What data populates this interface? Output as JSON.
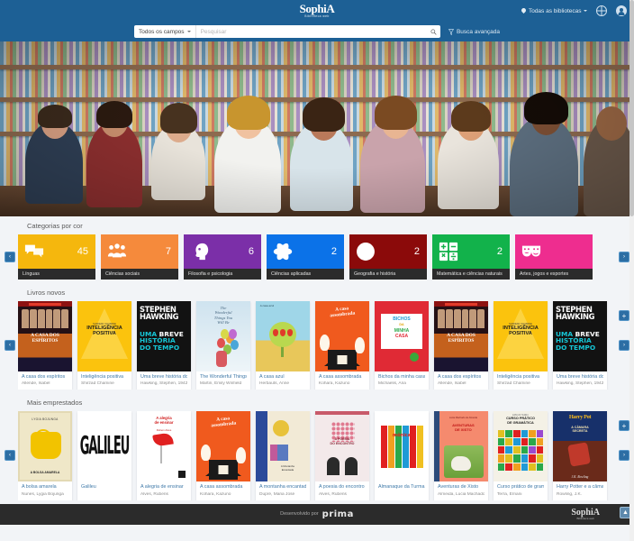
{
  "header": {
    "brand": "SophiA",
    "brand_sub": "Biblioteca web",
    "library_selector": "Todas as bibliotecas",
    "globe_icon": "globe-icon",
    "avatar_icon": "user-avatar-icon"
  },
  "search": {
    "field_selector": "Todos os campos",
    "placeholder": "Pesquisar",
    "value": "",
    "search_icon": "search-icon",
    "advanced_label": "Busca avançada",
    "filter_icon": "funnel-icon"
  },
  "hero": {
    "alt": "Estudantes em uma biblioteca"
  },
  "categories": {
    "title": "Categorias por cor",
    "prev_label": "‹",
    "next_label": "›",
    "items": [
      {
        "label": "Línguas",
        "count": "45",
        "color": "#f5b70d",
        "icon": "speech-bubbles-icon"
      },
      {
        "label": "Ciências sociais",
        "count": "7",
        "color": "#f58a3c",
        "icon": "people-group-icon"
      },
      {
        "label": "Filosofia e psicologia",
        "count": "6",
        "color": "#7b2fa8",
        "icon": "head-profile-icon"
      },
      {
        "label": "Ciências aplicadas",
        "count": "2",
        "color": "#0b72e8",
        "icon": "atom-icon"
      },
      {
        "label": "Geografia e história",
        "count": "2",
        "color": "#8b0a0a",
        "icon": "globe-grid-icon"
      },
      {
        "label": "Matemática e ciências naturais",
        "count": "2",
        "color": "#12b24b",
        "icon": "calculator-icon"
      },
      {
        "label": "Artes, jogos e esportes",
        "count": "",
        "color": "#ee2d8f",
        "icon": "theater-masks-icon"
      }
    ]
  },
  "new_books": {
    "title": "Livros novos",
    "prev_label": "‹",
    "next_label": "›",
    "expand_label": "+",
    "items": [
      {
        "title": "A casa dos espíritos",
        "author": "Allende, Isabel",
        "cover": "casa-espiritos"
      },
      {
        "title": "Inteligência positiva",
        "author": "Shirzad Chamine",
        "cover": "inteligencia"
      },
      {
        "title": "Uma breve história do tempo",
        "author": "Hawking, Stephen, 1942-",
        "cover": "hawking"
      },
      {
        "title": "The Wonderful Things You Will Be",
        "author": "Martin, Emily Winfield",
        "cover": "wonderful"
      },
      {
        "title": "A casa azul",
        "author": "Herbauts, Anne",
        "cover": "casa-azul"
      },
      {
        "title": "A casa assombrada",
        "author": "Kohara, Kazuno",
        "cover": "assombrada"
      },
      {
        "title": "Bichos da minha casa",
        "author": "Michaelis, Ana",
        "cover": "bichos"
      },
      {
        "title": "A casa dos espíritos",
        "author": "Allende, Isabel",
        "cover": "casa-espiritos"
      },
      {
        "title": "Inteligência positiva",
        "author": "Shirzad Chamine",
        "cover": "inteligencia"
      },
      {
        "title": "Uma breve história do tempo",
        "author": "Hawking, Stephen, 1942-",
        "cover": "hawking"
      }
    ]
  },
  "most_borrowed": {
    "title": "Mais emprestados",
    "prev_label": "‹",
    "next_label": "›",
    "expand_label": "+",
    "items": [
      {
        "title": "A bolsa amarela",
        "author": "Nunes, Lygia Bojunga",
        "cover": "bolsa"
      },
      {
        "title": "Galileu",
        "author": "",
        "cover": "galileu"
      },
      {
        "title": "A alegria de ensinar",
        "author": "Alves, Rubens",
        "cover": "alegria"
      },
      {
        "title": "A casa assombrada",
        "author": "Kohara, Kazuno",
        "cover": "assombrada"
      },
      {
        "title": "A montanha encantada",
        "author": "Dupré, Maria José",
        "cover": "montanha"
      },
      {
        "title": "A poesia do encontro",
        "author": "Alves, Rubens",
        "cover": "poesia"
      },
      {
        "title": "Almanaque da Turma da Mônica",
        "author": "",
        "cover": "monica"
      },
      {
        "title": "Aventuras de Xisto",
        "author": "Almeida, Lucia Machado de",
        "cover": "xisto"
      },
      {
        "title": "Curso prático de gramática",
        "author": "Terra, Ernani",
        "cover": "gramatica"
      },
      {
        "title": "Harry Potter e a câmara secreta",
        "author": "Rowling, J.K.",
        "cover": "harry"
      }
    ]
  },
  "footer": {
    "developed_by": "Desenvolvido por",
    "developer": "prima",
    "brand": "SophiA",
    "brand_sub": "Biblioteca web",
    "to_top_icon": "scroll-to-top-icon"
  }
}
